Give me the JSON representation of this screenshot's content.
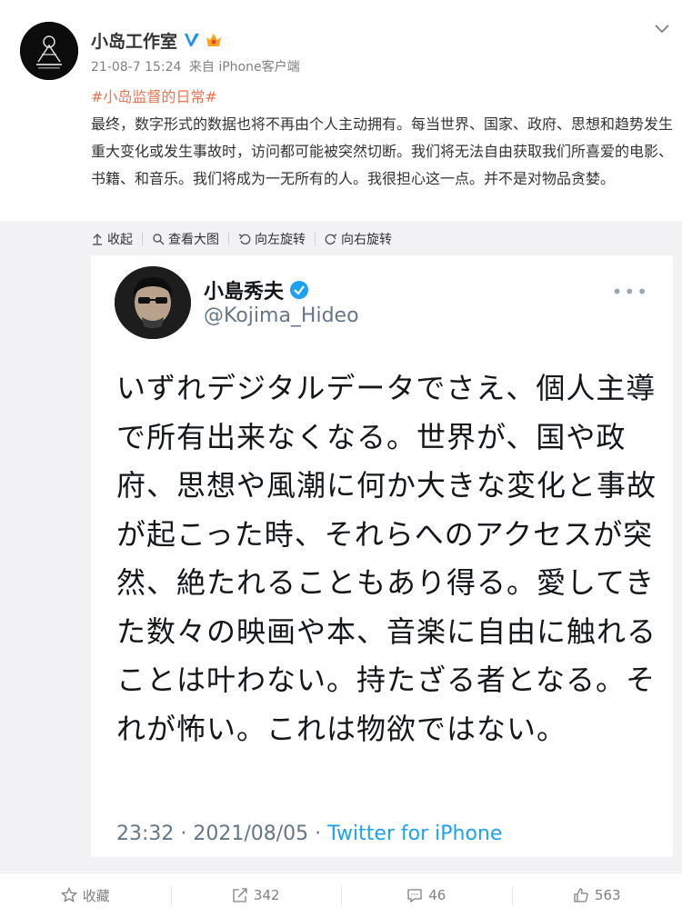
{
  "post": {
    "author": "小岛工作室",
    "timestamp": "21-08-7 15:24",
    "source": "来自 iPhone客户端",
    "hashtag": "#小岛监督的日常#",
    "text": "最终，数字形式的数据也将不再由个人主动拥有。每当世界、国家、政府、思想和趋势发生重大变化或发生事故时，访问都可能被突然切断。我们将无法自由获取我们所喜爱的电影、书籍、和音乐。我们将成为一无所有的人。我很担心这一点。并不是对物品贪婪。"
  },
  "image_tools": {
    "collapse": "收起",
    "view_large": "查看大图",
    "rotate_left": "向左旋转",
    "rotate_right": "向右旋转"
  },
  "tweet": {
    "name": "小島秀夫",
    "handle": "@Kojima_Hideo",
    "more": "•••",
    "text": "いずれデジタルデータでさえ、個人主導で所有出来なくなる。世界が、国や政府、思想や風潮に何か大きな変化と事故が起こった時、それらへのアクセスが突然、絶たれることもあり得る。愛してきた数々の映画や本、音楽に自由に触れることは叶わない。持たざる者となる。それが怖い。これは物欲ではない。",
    "time": "23:32 · 2021/08/05 · ",
    "source": "Twitter for iPhone"
  },
  "actions": {
    "favorite": "收藏",
    "repost": "342",
    "comment": "46",
    "like": "563"
  },
  "colors": {
    "hashtag": "#eb7350",
    "verified_v": "#1e90ff",
    "twitter_blue": "#1da1f2"
  }
}
